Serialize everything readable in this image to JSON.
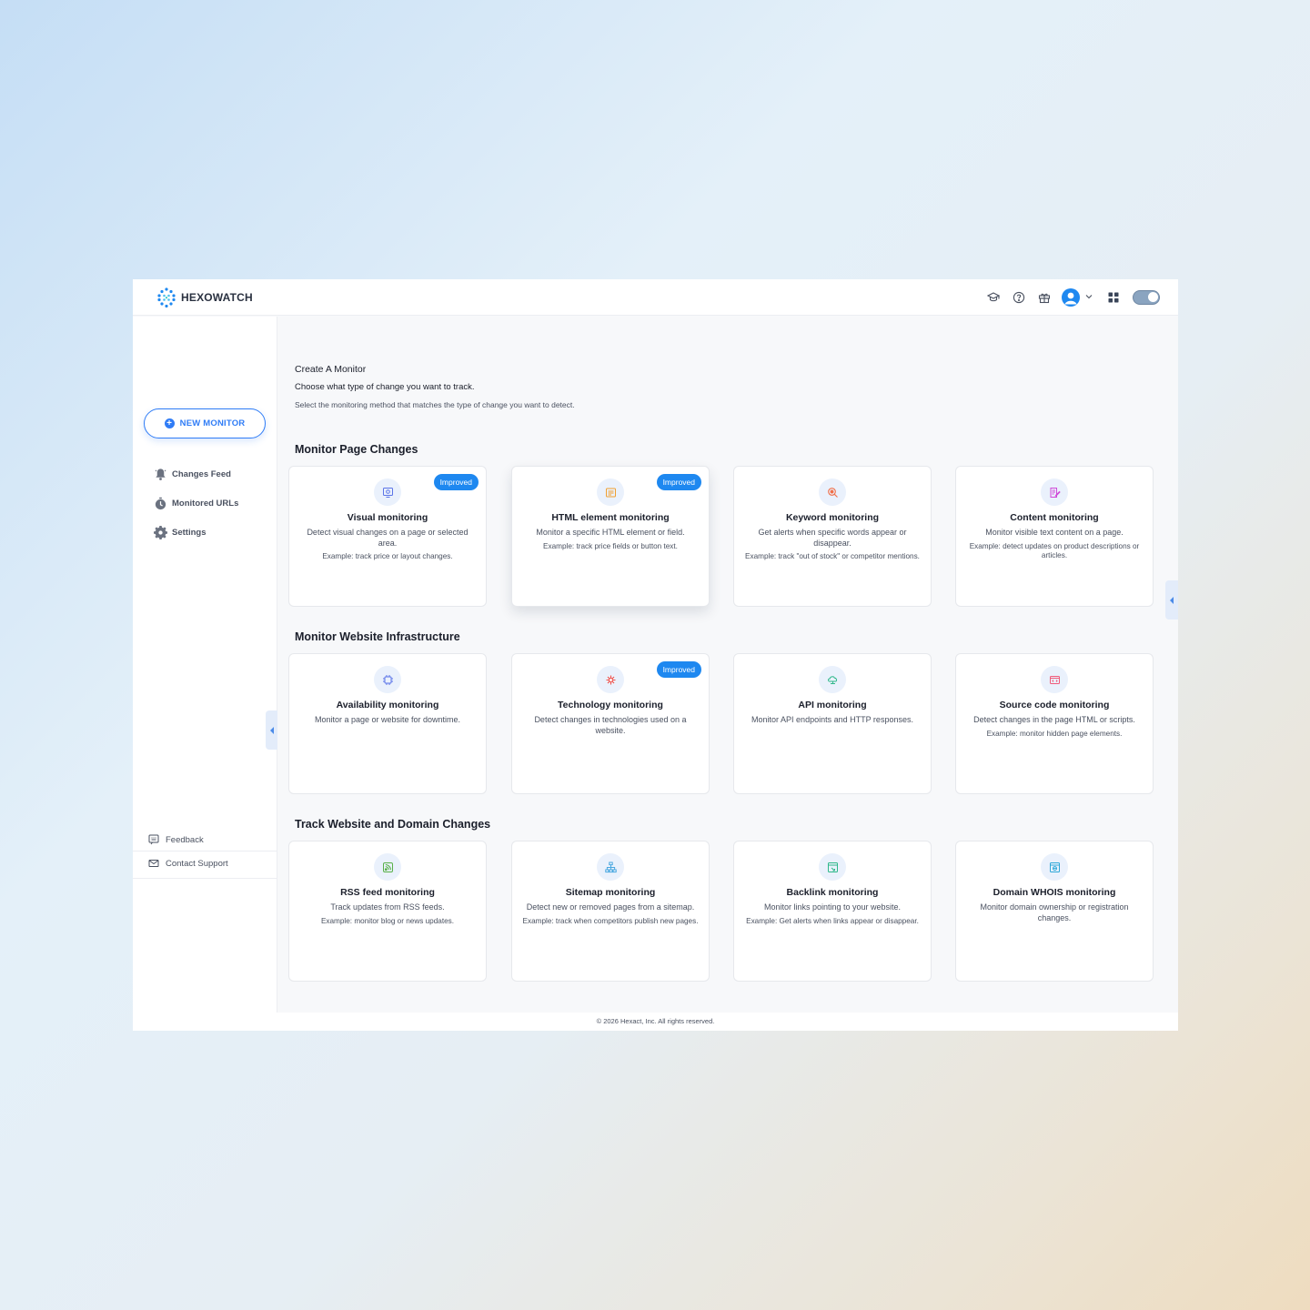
{
  "brand": {
    "name": "HEXOWATCH"
  },
  "topbar": {
    "icons": [
      "graduation-cap-icon",
      "help-circle-icon",
      "gift-icon",
      "user-avatar-icon",
      "chevron-down-icon",
      "apps-grid-icon"
    ],
    "theme_toggle": "on"
  },
  "sidebar": {
    "new_monitor_label": "NEW MONITOR",
    "items": [
      {
        "label": "Changes Feed",
        "icon": "bell-icon"
      },
      {
        "label": "Monitored URLs",
        "icon": "timer-icon"
      },
      {
        "label": "Settings",
        "icon": "gear-icon"
      }
    ],
    "footer": [
      {
        "label": "Feedback",
        "icon": "feedback-icon"
      },
      {
        "label": "Contact Support",
        "icon": "mail-icon"
      }
    ]
  },
  "main": {
    "title": "Create A Monitor",
    "subtitle": "Choose what type of change you want to track.",
    "description": "Select the monitoring method that matches the type of change you want to detect.",
    "sections": [
      {
        "title": "Monitor Page Changes",
        "cards": [
          {
            "title": "Visual monitoring",
            "desc": "Detect visual changes on a page or selected area.",
            "example": "Example: track price or layout changes.",
            "badge": "Improved",
            "icon": "visual-monitor-icon",
            "icon_color": "#5b74e8"
          },
          {
            "title": "HTML element monitoring",
            "desc": "Monitor a specific HTML element or field.",
            "example": "Example: track price fields or button text.",
            "badge": "Improved",
            "icon": "html-element-icon",
            "icon_color": "#f0a030"
          },
          {
            "title": "Keyword monitoring",
            "desc": "Get alerts when specific words appear or disappear.",
            "example": "Example: track \"out of stock\" or competitor mentions.",
            "badge": "",
            "icon": "keyword-search-icon",
            "icon_color": "#f0704a"
          },
          {
            "title": "Content monitoring",
            "desc": "Monitor visible text content on a page.",
            "example": "Example: detect updates on product descriptions or articles.",
            "badge": "",
            "icon": "content-edit-icon",
            "icon_color": "#d04ad8"
          }
        ]
      },
      {
        "title": "Monitor Website Infrastructure",
        "cards": [
          {
            "title": "Availability monitoring",
            "desc": "Monitor a page or website for downtime.",
            "example": "",
            "badge": "",
            "icon": "availability-icon",
            "icon_color": "#5b74e8"
          },
          {
            "title": "Technology monitoring",
            "desc": "Detect changes in technologies used on a website.",
            "example": "",
            "badge": "Improved",
            "icon": "technology-icon",
            "icon_color": "#f0504a"
          },
          {
            "title": "API monitoring",
            "desc": "Monitor API endpoints and HTTP responses.",
            "example": "",
            "badge": "",
            "icon": "api-cloud-icon",
            "icon_color": "#2fb88a"
          },
          {
            "title": "Source code monitoring",
            "desc": "Detect changes in the page HTML or scripts.",
            "example": "Example: monitor hidden page elements.",
            "badge": "",
            "icon": "source-code-icon",
            "icon_color": "#f05a7a"
          }
        ]
      },
      {
        "title": "Track Website and Domain Changes",
        "cards": [
          {
            "title": "RSS feed monitoring",
            "desc": "Track updates from RSS feeds.",
            "example": "Example: monitor blog or news updates.",
            "badge": "",
            "icon": "rss-feed-icon",
            "icon_color": "#58b048"
          },
          {
            "title": "Sitemap monitoring",
            "desc": "Detect new or removed pages from a sitemap.",
            "example": "Example: track when competitors publish new pages.",
            "badge": "",
            "icon": "sitemap-icon",
            "icon_color": "#4aa8e0"
          },
          {
            "title": "Backlink monitoring",
            "desc": "Monitor links pointing to your website.",
            "example": "Example: Get alerts when links appear or disappear.",
            "badge": "",
            "icon": "backlink-icon",
            "icon_color": "#2fb88a"
          },
          {
            "title": "Domain WHOIS monitoring",
            "desc": "Monitor domain ownership or registration changes.",
            "example": "",
            "badge": "",
            "icon": "whois-domain-icon",
            "icon_color": "#2fa8d8"
          }
        ]
      }
    ]
  },
  "footer": {
    "copyright": "© 2026 Hexact, Inc. All rights reserved."
  }
}
